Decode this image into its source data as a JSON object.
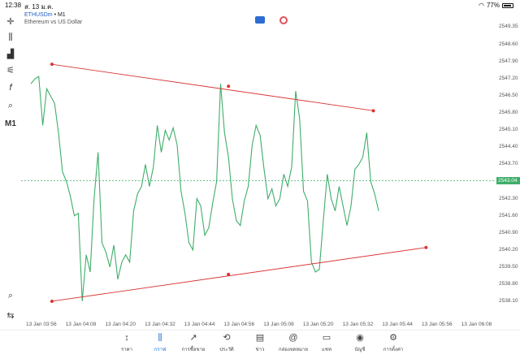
{
  "status_bar": {
    "time": "12:38",
    "date": "ส. 13 ม.ค.",
    "battery": "77%"
  },
  "header": {
    "symbol": "ETHUSDm",
    "timeframe_sep": " • ",
    "timeframe": "M1",
    "description": "Ethereum vs US Dollar"
  },
  "left_toolbar": {
    "timeframe_label": "M1"
  },
  "current_price": "2543.04",
  "chart_data": {
    "type": "line",
    "x_labels": [
      "13 Jan 03:56",
      "13 Jan 04:08",
      "13 Jan 04:20",
      "13 Jan 04:32",
      "13 Jan 04:44",
      "13 Jan 04:56",
      "13 Jan 05:08",
      "13 Jan 05:20",
      "13 Jan 05:32",
      "13 Jan 05:44",
      "13 Jan 05:56",
      "13 Jan 06:08"
    ],
    "y_ticks": [
      "2549.35",
      "2548.60",
      "2547.90",
      "2547.20",
      "2546.50",
      "2545.80",
      "2545.10",
      "2544.40",
      "2543.70",
      "2542.30",
      "2541.60",
      "2540.90",
      "2540.20",
      "2539.50",
      "2538.80",
      "2538.10"
    ],
    "ylim": [
      2537.6,
      2549.7
    ],
    "x_range_minutes": [
      0,
      132
    ],
    "series": [
      {
        "color": "#3fae6a",
        "points": [
          [
            0,
            2547.0
          ],
          [
            1.5,
            2547.2
          ],
          [
            3,
            2547.3
          ],
          [
            4.5,
            2545.3
          ],
          [
            6,
            2546.8
          ],
          [
            7.5,
            2546.5
          ],
          [
            9,
            2546.2
          ],
          [
            10.5,
            2545.0
          ],
          [
            12,
            2543.4
          ],
          [
            13.5,
            2543.0
          ],
          [
            15,
            2542.4
          ],
          [
            16.5,
            2541.6
          ],
          [
            18,
            2541.7
          ],
          [
            19.5,
            2538.1
          ],
          [
            21,
            2540.0
          ],
          [
            22.5,
            2539.3
          ],
          [
            24,
            2542.3
          ],
          [
            25.5,
            2544.2
          ],
          [
            27,
            2540.5
          ],
          [
            28.5,
            2540.1
          ],
          [
            30,
            2539.5
          ],
          [
            31.5,
            2540.4
          ],
          [
            33,
            2539.0
          ],
          [
            34.5,
            2539.7
          ],
          [
            36,
            2540.0
          ],
          [
            37.5,
            2539.7
          ],
          [
            39,
            2541.8
          ],
          [
            40.5,
            2542.5
          ],
          [
            42,
            2542.8
          ],
          [
            43.5,
            2543.7
          ],
          [
            45,
            2542.8
          ],
          [
            46.5,
            2543.6
          ],
          [
            48,
            2545.3
          ],
          [
            49.5,
            2544.2
          ],
          [
            51,
            2545.1
          ],
          [
            52.5,
            2544.7
          ],
          [
            54,
            2545.2
          ],
          [
            55.5,
            2544.5
          ],
          [
            57,
            2542.6
          ],
          [
            58.5,
            2541.7
          ],
          [
            60,
            2540.5
          ],
          [
            61.5,
            2540.2
          ],
          [
            63,
            2542.3
          ],
          [
            64.5,
            2542.0
          ],
          [
            66,
            2540.8
          ],
          [
            67.5,
            2541.1
          ],
          [
            69,
            2542.1
          ],
          [
            70.5,
            2543.0
          ],
          [
            72,
            2547.0
          ],
          [
            73.5,
            2545.0
          ],
          [
            75,
            2544.0
          ],
          [
            76.5,
            2542.3
          ],
          [
            78,
            2541.4
          ],
          [
            79.5,
            2541.2
          ],
          [
            81,
            2542.2
          ],
          [
            82.5,
            2542.8
          ],
          [
            84,
            2544.5
          ],
          [
            85.5,
            2545.3
          ],
          [
            87,
            2544.9
          ],
          [
            88.5,
            2543.5
          ],
          [
            90,
            2542.3
          ],
          [
            91.5,
            2542.7
          ],
          [
            93,
            2542.0
          ],
          [
            94.5,
            2542.3
          ],
          [
            96,
            2543.3
          ],
          [
            97.5,
            2542.8
          ],
          [
            99,
            2543.6
          ],
          [
            100.5,
            2546.7
          ],
          [
            102,
            2545.6
          ],
          [
            103.5,
            2542.6
          ],
          [
            105,
            2542.2
          ],
          [
            106.5,
            2539.7
          ],
          [
            108,
            2539.3
          ],
          [
            109.5,
            2539.4
          ],
          [
            111,
            2541.4
          ],
          [
            112.5,
            2543.3
          ],
          [
            114,
            2542.3
          ],
          [
            115.5,
            2541.8
          ],
          [
            117,
            2542.8
          ],
          [
            118.5,
            2542.0
          ],
          [
            120,
            2541.2
          ],
          [
            121.5,
            2542.0
          ],
          [
            123,
            2543.5
          ],
          [
            124.5,
            2543.7
          ],
          [
            126,
            2544.0
          ],
          [
            127.5,
            2545.0
          ],
          [
            129,
            2543.0
          ],
          [
            130.5,
            2542.5
          ],
          [
            132,
            2541.8
          ]
        ]
      }
    ],
    "trendlines": [
      {
        "color": "#d93636",
        "points": [
          [
            -1,
            2547.8
          ],
          [
            75,
            2546.9
          ],
          [
            130,
            2545.9
          ]
        ]
      },
      {
        "color": "#d93636",
        "points": [
          [
            -1,
            2538.1
          ],
          [
            75,
            2539.2
          ],
          [
            150,
            2540.3
          ]
        ]
      }
    ]
  },
  "bottom_nav": [
    {
      "label": "ราคา",
      "icon": "quotes-icon",
      "glyph": "↕"
    },
    {
      "label": "กราฟ",
      "icon": "chart-icon",
      "glyph": "⫼",
      "active": true
    },
    {
      "label": "การซื้อขาย",
      "icon": "trade-icon",
      "glyph": "↗"
    },
    {
      "label": "ประวัติ",
      "icon": "history-icon",
      "glyph": "⟲"
    },
    {
      "label": "ข่าว",
      "icon": "news-icon",
      "glyph": "▤"
    },
    {
      "label": "กล่องจดหมาย",
      "icon": "mailbox-icon",
      "glyph": "@"
    },
    {
      "label": "แชท",
      "icon": "chat-icon",
      "glyph": "▭"
    },
    {
      "label": "บัญชี",
      "icon": "account-icon",
      "glyph": "◉"
    },
    {
      "label": "การตั้งค่า",
      "icon": "settings-icon",
      "glyph": "⚙"
    }
  ]
}
